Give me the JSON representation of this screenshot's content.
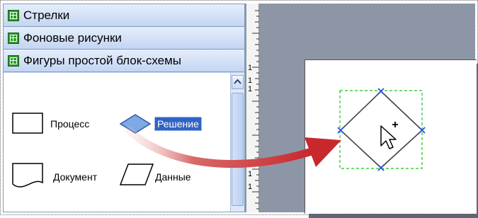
{
  "stencil": {
    "sections": [
      {
        "label": "Стрелки"
      },
      {
        "label": "Фоновые рисунки"
      },
      {
        "label": "Фигуры простой блок-схемы"
      }
    ],
    "shapes": [
      {
        "label": "Процесс",
        "icon": "process-shape-icon",
        "selected": false
      },
      {
        "label": "Решение",
        "icon": "decision-shape-icon",
        "selected": true
      },
      {
        "label": "Документ",
        "icon": "document-shape-icon",
        "selected": false
      },
      {
        "label": "Данные",
        "icon": "data-shape-icon",
        "selected": false
      }
    ]
  },
  "canvas": {
    "ruler_labels": [
      "1",
      "1",
      "1",
      "1",
      "1"
    ],
    "dropped_shape": "decision-shape-icon",
    "selection_color": "#19c419",
    "handle_color": "#2c4fd8"
  },
  "drag_arrow_color": "#c8282c"
}
